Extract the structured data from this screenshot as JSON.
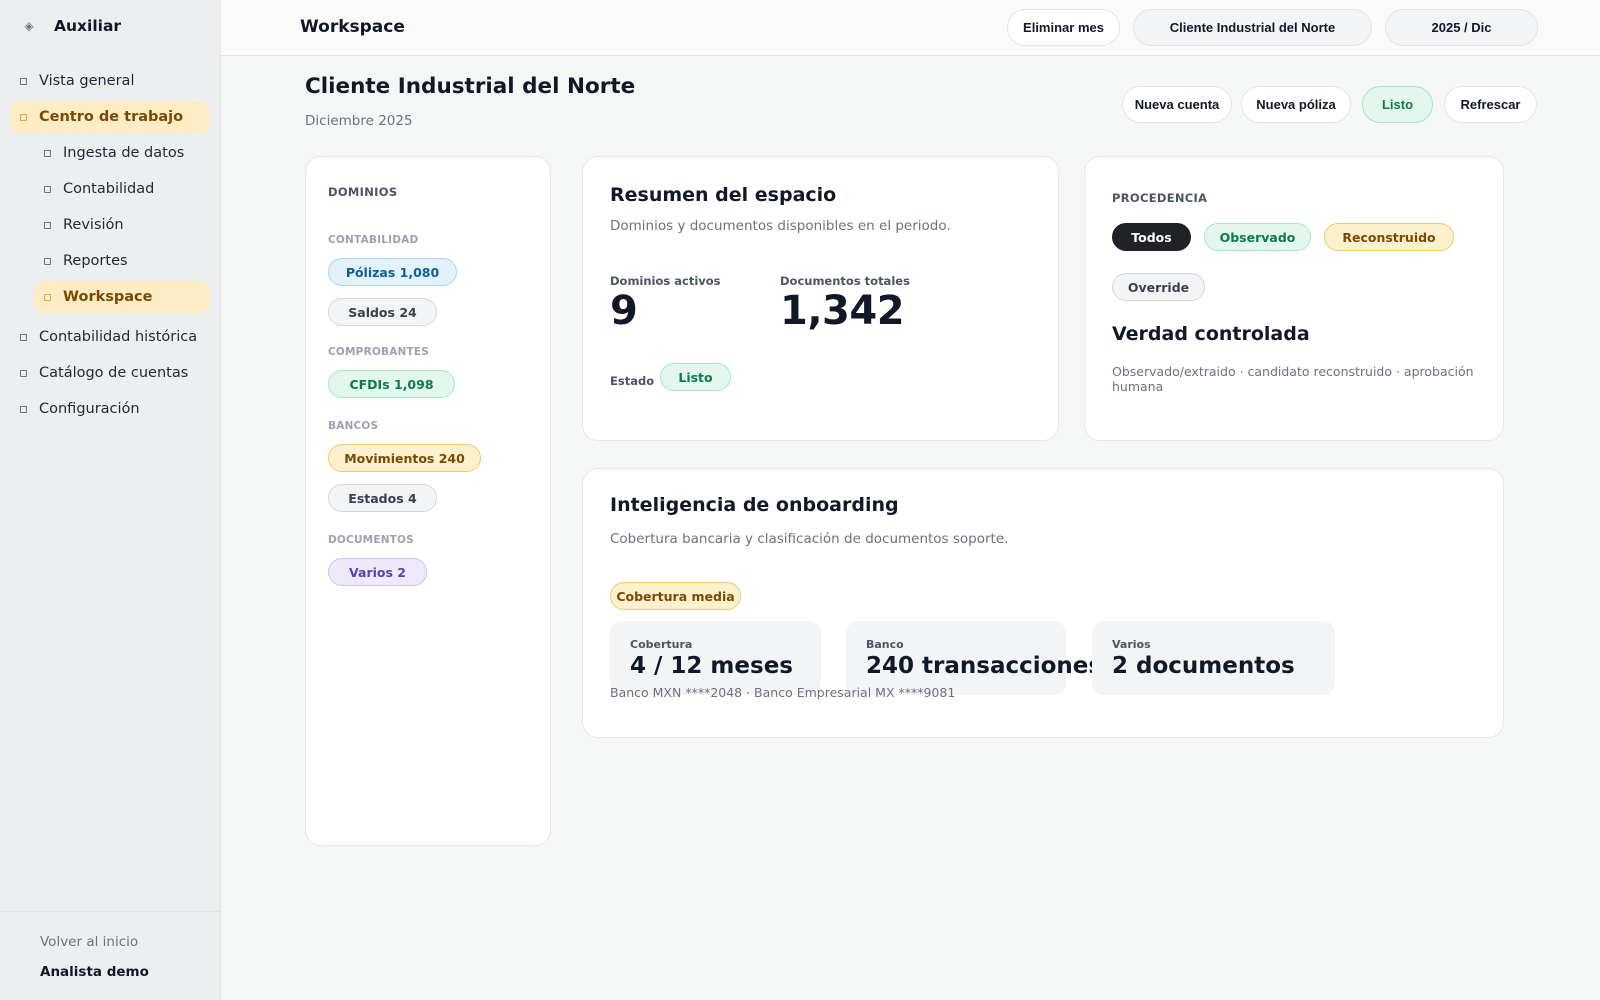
{
  "sidebar": {
    "brand_icon": "◈",
    "brand": "Auxiliar",
    "items": [
      {
        "label": "Vista general"
      },
      {
        "label": "Centro de trabajo",
        "active": true
      },
      {
        "label": "Ingesta de datos"
      },
      {
        "label": "Contabilidad"
      },
      {
        "label": "Revisión"
      },
      {
        "label": "Reportes"
      },
      {
        "label": "Workspace",
        "active": true
      },
      {
        "label": "Contabilidad histórica"
      },
      {
        "label": "Catálogo de cuentas"
      },
      {
        "label": "Configuración"
      }
    ],
    "back_link": "Volver al inicio",
    "user": "Analista demo"
  },
  "topbar": {
    "title": "Workspace",
    "delete_month": "Eliminar mes",
    "client": "Cliente Industrial del Norte",
    "period": "2025 / Dic"
  },
  "page": {
    "title": "Cliente Industrial del Norte",
    "subtitle": "Diciembre 2025",
    "actions": {
      "new_account": "Nueva cuenta",
      "new_policy": "Nueva póliza",
      "ready": "Listo",
      "refresh": "Refrescar"
    }
  },
  "domains": {
    "title": "DOMINIOS",
    "groups": [
      {
        "label": "CONTABILIDAD",
        "chips": [
          "Pólizas 1,080",
          "Saldos 24"
        ]
      },
      {
        "label": "COMPROBANTES",
        "chips": [
          "CFDIs 1,098"
        ]
      },
      {
        "label": "BANCOS",
        "chips": [
          "Movimientos 240",
          "Estados 4"
        ]
      },
      {
        "label": "DOCUMENTOS",
        "chips": [
          "Varios 2"
        ]
      }
    ]
  },
  "summary": {
    "title": "Resumen del espacio",
    "desc": "Dominios y documentos disponibles en el periodo.",
    "active_domains_label": "Dominios activos",
    "active_domains": "9",
    "total_docs_label": "Documentos totales",
    "total_docs": "1,342",
    "status_label": "Estado",
    "status": "Listo"
  },
  "provenance": {
    "title": "PROCEDENCIA",
    "filters": [
      "Todos",
      "Observado",
      "Reconstruido",
      "Override"
    ],
    "heading": "Verdad controlada",
    "desc": "Observado/extraido · candidato reconstruido · aprobación humana"
  },
  "onboarding": {
    "title": "Inteligencia de onboarding",
    "desc": "Cobertura bancaria y clasificación de documentos soporte.",
    "badge": "Cobertura media",
    "coverage_label": "Cobertura",
    "coverage": "4 / 12 meses",
    "bank_label": "Banco",
    "bank": "240 transacciones",
    "misc_label": "Varios",
    "misc": "2 documentos",
    "banks_note": "Banco MXN ****2048 · Banco Empresarial MX ****9081"
  }
}
